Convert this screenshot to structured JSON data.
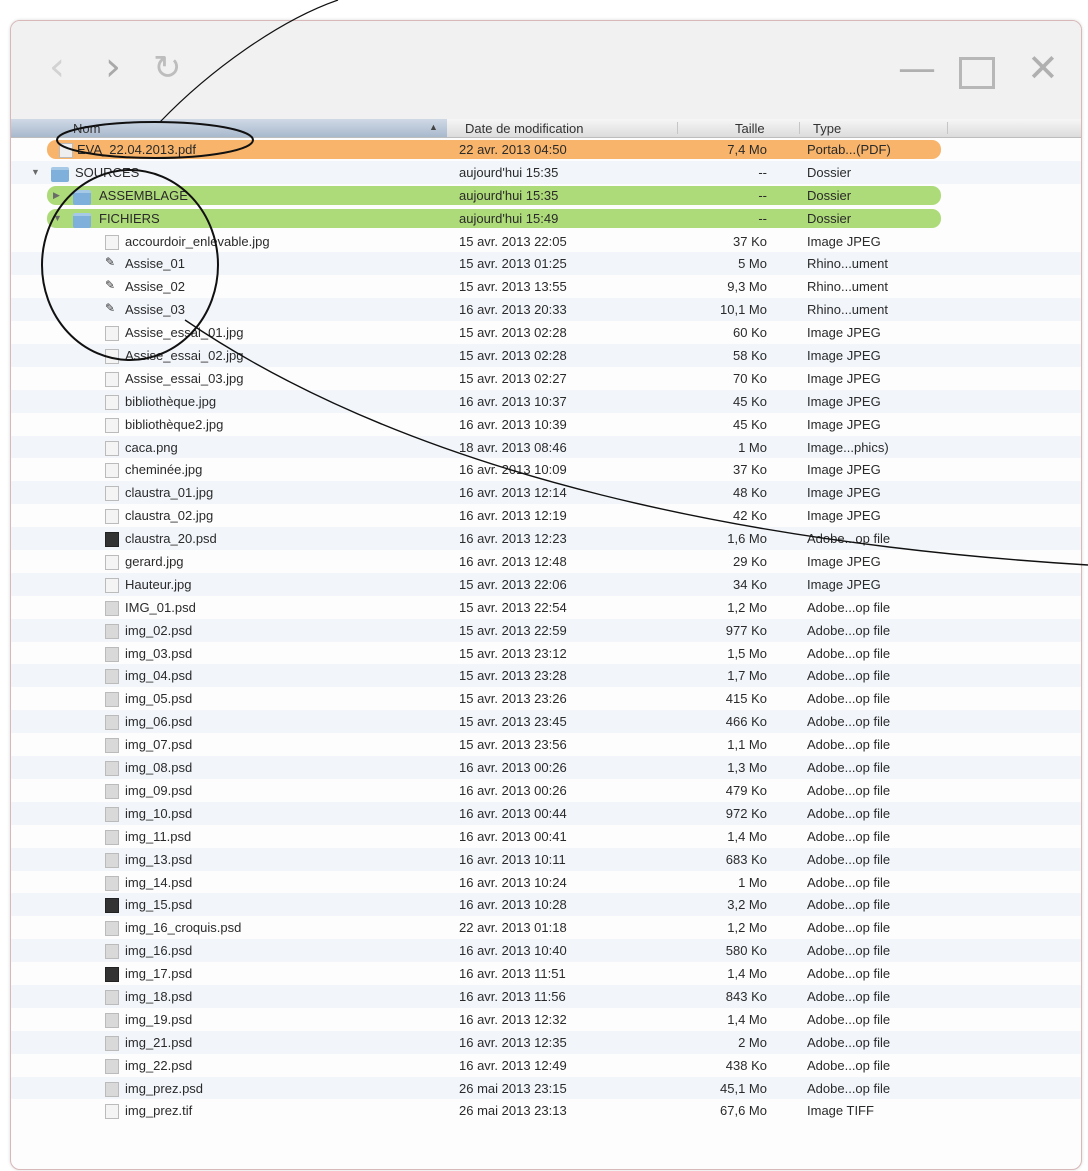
{
  "columns": {
    "name": "Nom",
    "date": "Date de modification",
    "size": "Taille",
    "type": "Type"
  },
  "rows": [
    {
      "name": "EVA_22.04.2013.pdf",
      "date": "22 avr. 2013 04:50",
      "size": "7,4 Mo",
      "type": "Portab...(PDF)"
    },
    {
      "name": "SOURCES",
      "date": "aujourd'hui 15:35",
      "size": "--",
      "type": "Dossier"
    },
    {
      "name": "ASSEMBLAGE",
      "date": "aujourd'hui 15:35",
      "size": "--",
      "type": "Dossier"
    },
    {
      "name": "FICHIERS",
      "date": "aujourd'hui 15:49",
      "size": "--",
      "type": "Dossier"
    },
    {
      "name": "accourdoir_enlevable.jpg",
      "date": "15 avr. 2013 22:05",
      "size": "37 Ko",
      "type": "Image JPEG"
    },
    {
      "name": "Assise_01",
      "date": "15 avr. 2013 01:25",
      "size": "5 Mo",
      "type": "Rhino...ument"
    },
    {
      "name": "Assise_02",
      "date": "15 avr. 2013 13:55",
      "size": "9,3 Mo",
      "type": "Rhino...ument"
    },
    {
      "name": "Assise_03",
      "date": "16 avr. 2013 20:33",
      "size": "10,1 Mo",
      "type": "Rhino...ument"
    },
    {
      "name": "Assise_essai_01.jpg",
      "date": "15 avr. 2013 02:28",
      "size": "60 Ko",
      "type": "Image JPEG"
    },
    {
      "name": "Assise_essai_02.jpg",
      "date": "15 avr. 2013 02:28",
      "size": "58 Ko",
      "type": "Image JPEG"
    },
    {
      "name": "Assise_essai_03.jpg",
      "date": "15 avr. 2013 02:27",
      "size": "70 Ko",
      "type": "Image JPEG"
    },
    {
      "name": "bibliothèque.jpg",
      "date": "16 avr. 2013 10:37",
      "size": "45 Ko",
      "type": "Image JPEG"
    },
    {
      "name": "bibliothèque2.jpg",
      "date": "16 avr. 2013 10:39",
      "size": "45 Ko",
      "type": "Image JPEG"
    },
    {
      "name": "caca.png",
      "date": "18 avr. 2013 08:46",
      "size": "1 Mo",
      "type": "Image...phics)"
    },
    {
      "name": "cheminée.jpg",
      "date": "16 avr. 2013 10:09",
      "size": "37 Ko",
      "type": "Image JPEG"
    },
    {
      "name": "claustra_01.jpg",
      "date": "16 avr. 2013 12:14",
      "size": "48 Ko",
      "type": "Image JPEG"
    },
    {
      "name": "claustra_02.jpg",
      "date": "16 avr. 2013 12:19",
      "size": "42 Ko",
      "type": "Image JPEG"
    },
    {
      "name": "claustra_20.psd",
      "date": "16 avr. 2013 12:23",
      "size": "1,6 Mo",
      "type": "Adobe...op file"
    },
    {
      "name": "gerard.jpg",
      "date": "16 avr. 2013 12:48",
      "size": "29 Ko",
      "type": "Image JPEG"
    },
    {
      "name": "Hauteur.jpg",
      "date": "15 avr. 2013 22:06",
      "size": "34 Ko",
      "type": "Image JPEG"
    },
    {
      "name": "IMG_01.psd",
      "date": "15 avr. 2013 22:54",
      "size": "1,2 Mo",
      "type": "Adobe...op file"
    },
    {
      "name": "img_02.psd",
      "date": "15 avr. 2013 22:59",
      "size": "977 Ko",
      "type": "Adobe...op file"
    },
    {
      "name": "img_03.psd",
      "date": "15 avr. 2013 23:12",
      "size": "1,5 Mo",
      "type": "Adobe...op file"
    },
    {
      "name": "img_04.psd",
      "date": "15 avr. 2013 23:28",
      "size": "1,7 Mo",
      "type": "Adobe...op file"
    },
    {
      "name": "img_05.psd",
      "date": "15 avr. 2013 23:26",
      "size": "415 Ko",
      "type": "Adobe...op file"
    },
    {
      "name": "img_06.psd",
      "date": "15 avr. 2013 23:45",
      "size": "466 Ko",
      "type": "Adobe...op file"
    },
    {
      "name": "img_07.psd",
      "date": "15 avr. 2013 23:56",
      "size": "1,1 Mo",
      "type": "Adobe...op file"
    },
    {
      "name": "img_08.psd",
      "date": "16 avr. 2013 00:26",
      "size": "1,3 Mo",
      "type": "Adobe...op file"
    },
    {
      "name": "img_09.psd",
      "date": "16 avr. 2013 00:26",
      "size": "479 Ko",
      "type": "Adobe...op file"
    },
    {
      "name": "img_10.psd",
      "date": "16 avr. 2013 00:44",
      "size": "972 Ko",
      "type": "Adobe...op file"
    },
    {
      "name": "img_11.psd",
      "date": "16 avr. 2013 00:41",
      "size": "1,4 Mo",
      "type": "Adobe...op file"
    },
    {
      "name": "img_13.psd",
      "date": "16 avr. 2013 10:11",
      "size": "683 Ko",
      "type": "Adobe...op file"
    },
    {
      "name": "img_14.psd",
      "date": "16 avr. 2013 10:24",
      "size": "1 Mo",
      "type": "Adobe...op file"
    },
    {
      "name": "img_15.psd",
      "date": "16 avr. 2013 10:28",
      "size": "3,2 Mo",
      "type": "Adobe...op file"
    },
    {
      "name": "img_16_croquis.psd",
      "date": "22 avr. 2013 01:18",
      "size": "1,2 Mo",
      "type": "Adobe...op file"
    },
    {
      "name": "img_16.psd",
      "date": "16 avr. 2013 10:40",
      "size": "580 Ko",
      "type": "Adobe...op file"
    },
    {
      "name": "img_17.psd",
      "date": "16 avr. 2013 11:51",
      "size": "1,4 Mo",
      "type": "Adobe...op file"
    },
    {
      "name": "img_18.psd",
      "date": "16 avr. 2013 11:56",
      "size": "843 Ko",
      "type": "Adobe...op file"
    },
    {
      "name": "img_19.psd",
      "date": "16 avr. 2013 12:32",
      "size": "1,4 Mo",
      "type": "Adobe...op file"
    },
    {
      "name": "img_21.psd",
      "date": "16 avr. 2013 12:35",
      "size": "2 Mo",
      "type": "Adobe...op file"
    },
    {
      "name": "img_22.psd",
      "date": "16 avr. 2013 12:49",
      "size": "438 Ko",
      "type": "Adobe...op file"
    },
    {
      "name": "img_prez.psd",
      "date": "26 mai 2013 23:15",
      "size": "45,1 Mo",
      "type": "Adobe...op file"
    },
    {
      "name": "img_prez.tif",
      "date": "26 mai 2013 23:13",
      "size": "67,6 Mo",
      "type": "Image TIFF"
    }
  ]
}
